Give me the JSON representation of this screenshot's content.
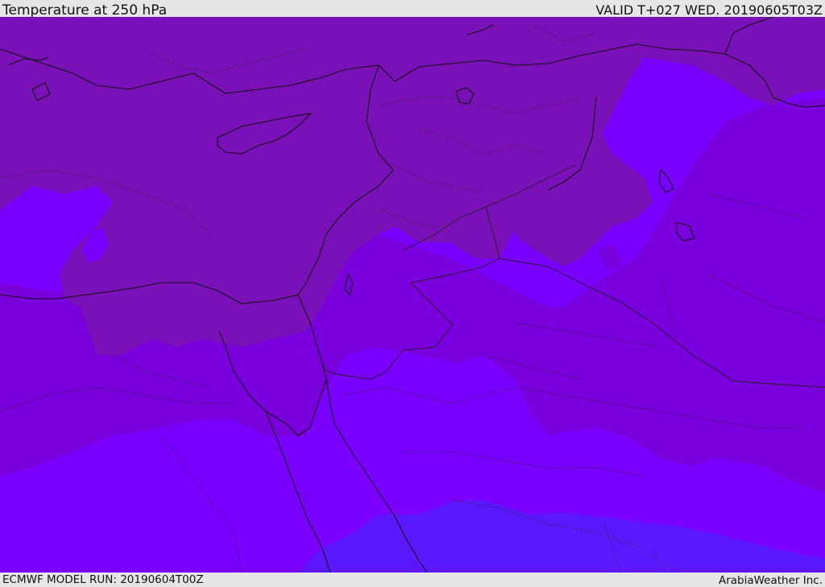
{
  "header": {
    "title": "Temperature at 250 hPa",
    "valid": "VALID T+027 WED. 20190605T03Z"
  },
  "footer": {
    "model_run": "ECMWF MODEL RUN: 20190604T00Z",
    "credit": "ArabiaWeather Inc."
  },
  "map": {
    "field": "temperature",
    "level": "250 hPa",
    "colors": {
      "warmest": "#5b17ff",
      "warm": "#7a00ff",
      "mid": "#7900dd",
      "cool": "#7a10b8",
      "coast_line": "#111111",
      "border_line": "#222222"
    }
  }
}
